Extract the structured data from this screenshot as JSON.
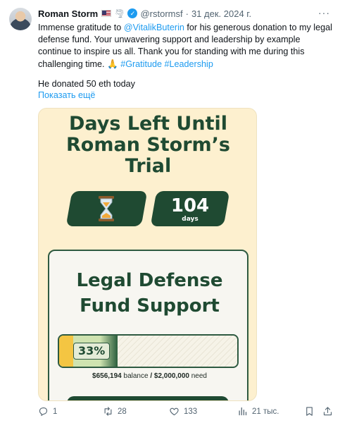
{
  "tweet": {
    "author_name": "Roman Storm",
    "emoji_tornado": "🌪",
    "handle": "@rstormsf",
    "separator": "·",
    "date": "31 дек. 2024 г.",
    "more_glyph": "···",
    "text_part1": "Immense gratitude to ",
    "mention": "@VitalikButerin",
    "text_part2": " for his generous donation to my legal defense fund. Your unwavering support and leadership by example continue to inspire us all. Thank you for standing with me during this challenging time. 🙏 ",
    "hashtag1": "#Gratitude",
    "hashtag2": "#Leadership",
    "line2": "He donated 50 eth today",
    "show_more": "Показать ещё"
  },
  "media": {
    "title_line1": "Days Left Until",
    "title_line2": "Roman Storm’s",
    "title_line3": "Trial",
    "days_count": "104",
    "days_label": "days",
    "card_title_line1": "Legal Defense",
    "card_title_line2": "Fund Support",
    "progress_percent_label": "33%",
    "progress_fraction": 0.33,
    "balance_amount": "$656,194",
    "balance_label": "balance",
    "slash": "/",
    "need_amount": "$2,000,000",
    "need_label": "need"
  },
  "actions": {
    "replies": "1",
    "reposts": "28",
    "likes": "133",
    "views": "21 тыс."
  },
  "icons": {
    "verified": "verified-badge-icon",
    "reply": "reply-icon",
    "repost": "repost-icon",
    "like": "heart-icon",
    "views": "views-icon",
    "bookmark": "bookmark-icon",
    "share": "share-icon",
    "hourglass": "hourglass-icon"
  },
  "colors": {
    "link": "#1d9bf0",
    "media_bg": "#fdf0cf",
    "dark_green": "#1f4a32",
    "muted_text": "#536471"
  }
}
